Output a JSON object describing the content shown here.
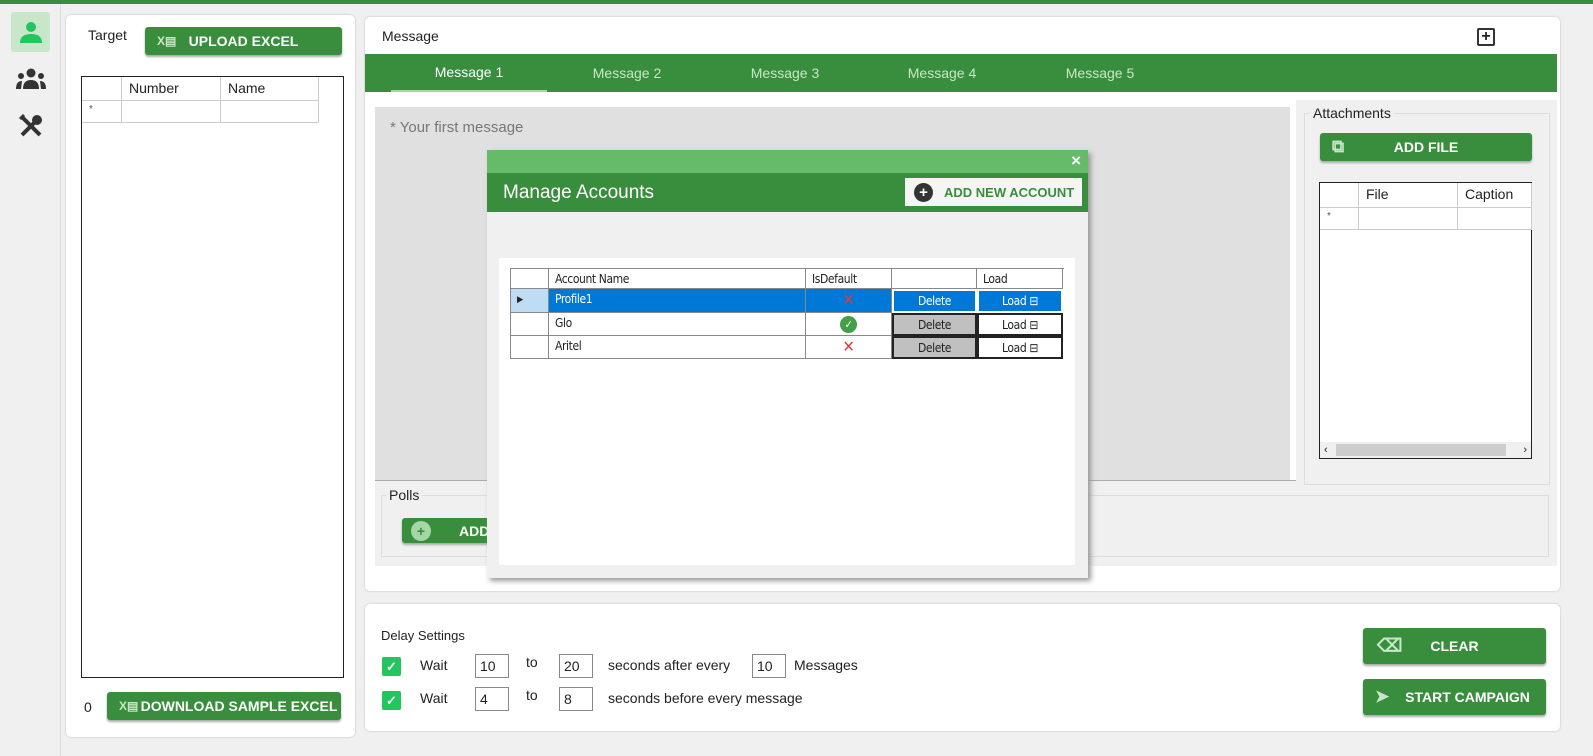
{
  "sidebar": {
    "items": [
      {
        "icon": "user-icon",
        "active": true
      },
      {
        "icon": "group-icon",
        "active": false
      },
      {
        "icon": "tools-icon",
        "active": false
      }
    ]
  },
  "target": {
    "label": "Target",
    "upload_label": "UPLOAD EXCEL",
    "columns": [
      "Number",
      "Name"
    ],
    "new_row_marker": "*",
    "count": "0",
    "download_label": "DOWNLOAD SAMPLE EXCEL"
  },
  "message": {
    "label": "Message",
    "tabs": [
      "Message 1",
      "Message 2",
      "Message 3",
      "Message 4",
      "Message 5"
    ],
    "active_tab": 0,
    "placeholder": "* Your first message"
  },
  "attachments": {
    "label": "Attachments",
    "add_file_label": "ADD FILE",
    "columns": [
      "File",
      "Caption"
    ],
    "new_row_marker": "*"
  },
  "polls": {
    "label": "Polls",
    "add_label": "ADD"
  },
  "modal": {
    "title": "Manage Accounts",
    "close": "×",
    "add_account_label": "ADD NEW ACCOUNT",
    "columns": [
      "Account Name",
      "IsDefault",
      "",
      "Load"
    ],
    "rows": [
      {
        "name": "Profile1",
        "is_default": false,
        "delete": "Delete",
        "load": "Load",
        "selected": true
      },
      {
        "name": "Glo",
        "is_default": true,
        "delete": "Delete",
        "load": "Load",
        "selected": false
      },
      {
        "name": "Aritel",
        "is_default": false,
        "delete": "Delete",
        "load": "Load",
        "selected": false
      }
    ]
  },
  "delay": {
    "label": "Delay Settings",
    "row1": {
      "checked": true,
      "wait": "Wait",
      "from": "10",
      "to_label": "to",
      "to": "20",
      "text": "seconds after every",
      "count": "10",
      "suffix": "Messages"
    },
    "row2": {
      "checked": true,
      "wait": "Wait",
      "from": "4",
      "to_label": "to",
      "to": "8",
      "text": "seconds before every message"
    }
  },
  "actions": {
    "clear_label": "CLEAR",
    "start_label": "START CAMPAIGN"
  },
  "colors": {
    "primary": "#388e3c",
    "light": "#66bb6a",
    "selection": "#0078d7"
  }
}
